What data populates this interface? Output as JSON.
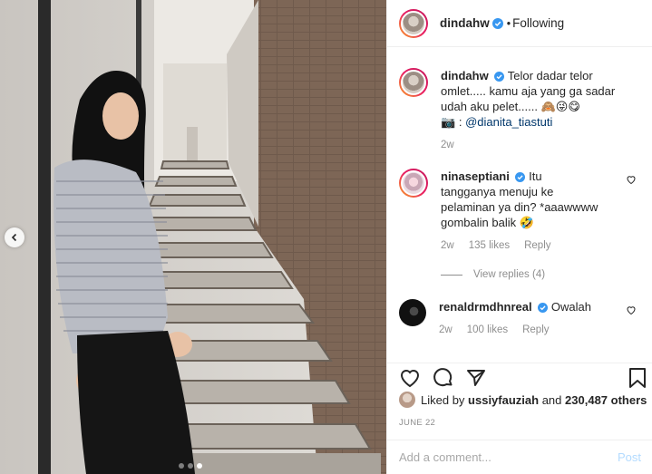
{
  "post": {
    "author": "dindahw",
    "follow_separator": "•",
    "follow_status": "Following",
    "carousel_dots": 3,
    "carousel_active": 3
  },
  "caption": {
    "username": "dindahw",
    "text": "Telor dadar telor omlet..... kamu aja yang ga sadar udah aku pelet...... 🙈😜😋",
    "credit_icon": "📷",
    "credit_sep": ":",
    "credit_tag": "@dianita_tiastuti",
    "time": "2w"
  },
  "comments": [
    {
      "username": "ninaseptiani",
      "text": "Itu tangganya menuju ke pelaminan ya din? *aaawwww gombalin balik 🤣",
      "time": "2w",
      "likes": "135 likes",
      "reply": "Reply",
      "view_replies": "View replies (4)"
    },
    {
      "username": "renaldrmdhnreal",
      "text": "Owalah",
      "time": "2w",
      "likes": "100 likes",
      "reply": "Reply"
    }
  ],
  "engagement": {
    "liked_by_prefix": "Liked by",
    "liked_by_user": "ussiyfauziah",
    "and_text": "and",
    "others": "230,487 others",
    "date": "JUNE 22"
  },
  "composer": {
    "placeholder": "Add a comment...",
    "post_label": "Post"
  },
  "colors": {
    "verified": "#3897f0",
    "link": "#00376b",
    "muted": "#8e8e8e",
    "post_disabled": "#b3dbff"
  }
}
